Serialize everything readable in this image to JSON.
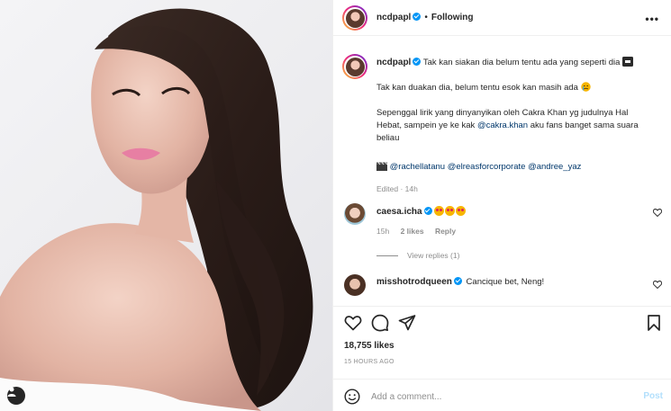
{
  "post": {
    "username": "ncdpapl",
    "follow_status": "Following",
    "more_label": "•••"
  },
  "caption": {
    "username": "ncdpapl",
    "line1": "Tak kan siakan dia belum tentu ada yang seperti dia",
    "line2": "Tak kan duakan dia, belum tentu esok kan masih ada",
    "para3_a": "Sepenggal lirik yang dinyanyikan oleh Cakra Khan yg judulnya Hal",
    "para3_b": "Hebat, sampein ye ke kak ",
    "para3_link": "@cakra.khan",
    "para3_c": " aku fans banget sama suara",
    "para3_d": "beliau",
    "mention1": "@rachellatanu",
    "mention2": "@elreasforcorporate",
    "mention3": "@andree_yaz",
    "edited": "Edited · 14h"
  },
  "comments": [
    {
      "username": "caesa.icha",
      "time": "15h",
      "likes": "2 likes",
      "reply": "Reply",
      "view_replies": "View replies (1)"
    },
    {
      "username": "misshotrodqueen",
      "text": "Cancique bet, Neng!"
    }
  ],
  "stats": {
    "likes": "18,755 likes",
    "time": "15 HOURS AGO"
  },
  "compose": {
    "placeholder": "Add a comment...",
    "post_label": "Post"
  },
  "icons": {
    "heart": "heart-icon",
    "comment": "comment-icon",
    "share": "share-icon",
    "save": "bookmark-icon",
    "emoji": "smiley-icon",
    "tag": "user-tag-icon"
  },
  "colors": {
    "link": "#00376b",
    "verified": "#0095f6",
    "muted": "#8e8e8e",
    "post_disabled": "#b2dffc"
  }
}
